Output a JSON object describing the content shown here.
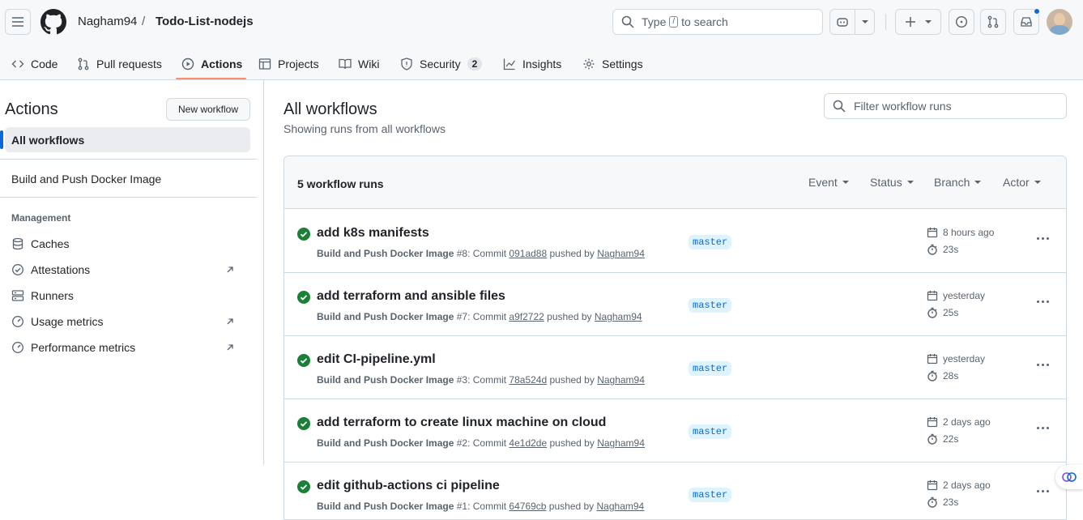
{
  "header": {
    "owner": "Nagham94",
    "separator": "/",
    "repo": "Todo-List-nodejs",
    "search_prefix": "Type",
    "search_key": "/",
    "search_suffix": "to search"
  },
  "tabs": [
    {
      "label": "Code",
      "icon": "code-icon"
    },
    {
      "label": "Pull requests",
      "icon": "pull-request-icon"
    },
    {
      "label": "Actions",
      "icon": "play-icon",
      "active": true
    },
    {
      "label": "Projects",
      "icon": "table-icon"
    },
    {
      "label": "Wiki",
      "icon": "book-icon"
    },
    {
      "label": "Security",
      "icon": "shield-icon",
      "count": "2"
    },
    {
      "label": "Insights",
      "icon": "graph-icon"
    },
    {
      "label": "Settings",
      "icon": "gear-icon"
    }
  ],
  "sidebar": {
    "title": "Actions",
    "new_workflow": "New workflow",
    "all_workflows": "All workflows",
    "workflow": "Build and Push Docker Image",
    "management_heading": "Management",
    "items": [
      {
        "label": "Caches",
        "icon": "database-icon"
      },
      {
        "label": "Attestations",
        "icon": "verified-icon",
        "external": true
      },
      {
        "label": "Runners",
        "icon": "server-icon"
      },
      {
        "label": "Usage metrics",
        "icon": "meter-icon",
        "external": true
      },
      {
        "label": "Performance metrics",
        "icon": "meter-icon",
        "external": true
      }
    ]
  },
  "main": {
    "title": "All workflows",
    "subtitle": "Showing runs from all workflows",
    "filter_placeholder": "Filter workflow runs",
    "run_count": "5 workflow runs",
    "filters": [
      "Event",
      "Status",
      "Branch",
      "Actor"
    ],
    "runs": [
      {
        "title": "add k8s manifests",
        "workflow": "Build and Push Docker Image",
        "number": "#8",
        "commit": "091ad88",
        "user": "Nagham94",
        "branch": "master",
        "when": "8 hours ago",
        "duration": "23s"
      },
      {
        "title": "add terraform and ansible files",
        "workflow": "Build and Push Docker Image",
        "number": "#7",
        "commit": "a9f2722",
        "user": "Nagham94",
        "branch": "master",
        "when": "yesterday",
        "duration": "25s"
      },
      {
        "title": "edit CI-pipeline.yml",
        "workflow": "Build and Push Docker Image",
        "number": "#3",
        "commit": "78a524d",
        "user": "Nagham94",
        "branch": "master",
        "when": "yesterday",
        "duration": "28s"
      },
      {
        "title": "add terraform to create linux machine on cloud",
        "workflow": "Build and Push Docker Image",
        "number": "#2",
        "commit": "4e1d2de",
        "user": "Nagham94",
        "branch": "master",
        "when": "2 days ago",
        "duration": "22s"
      },
      {
        "title": "edit github-actions ci pipeline",
        "workflow": "Build and Push Docker Image",
        "number": "#1",
        "commit": "64769cb",
        "user": "Nagham94",
        "branch": "master",
        "when": "2 days ago",
        "duration": "23s"
      }
    ]
  },
  "colors": {
    "accent": "#0969da",
    "success": "#1a7f37",
    "tab_underline": "#fd8c73",
    "notification": "#0969da"
  }
}
